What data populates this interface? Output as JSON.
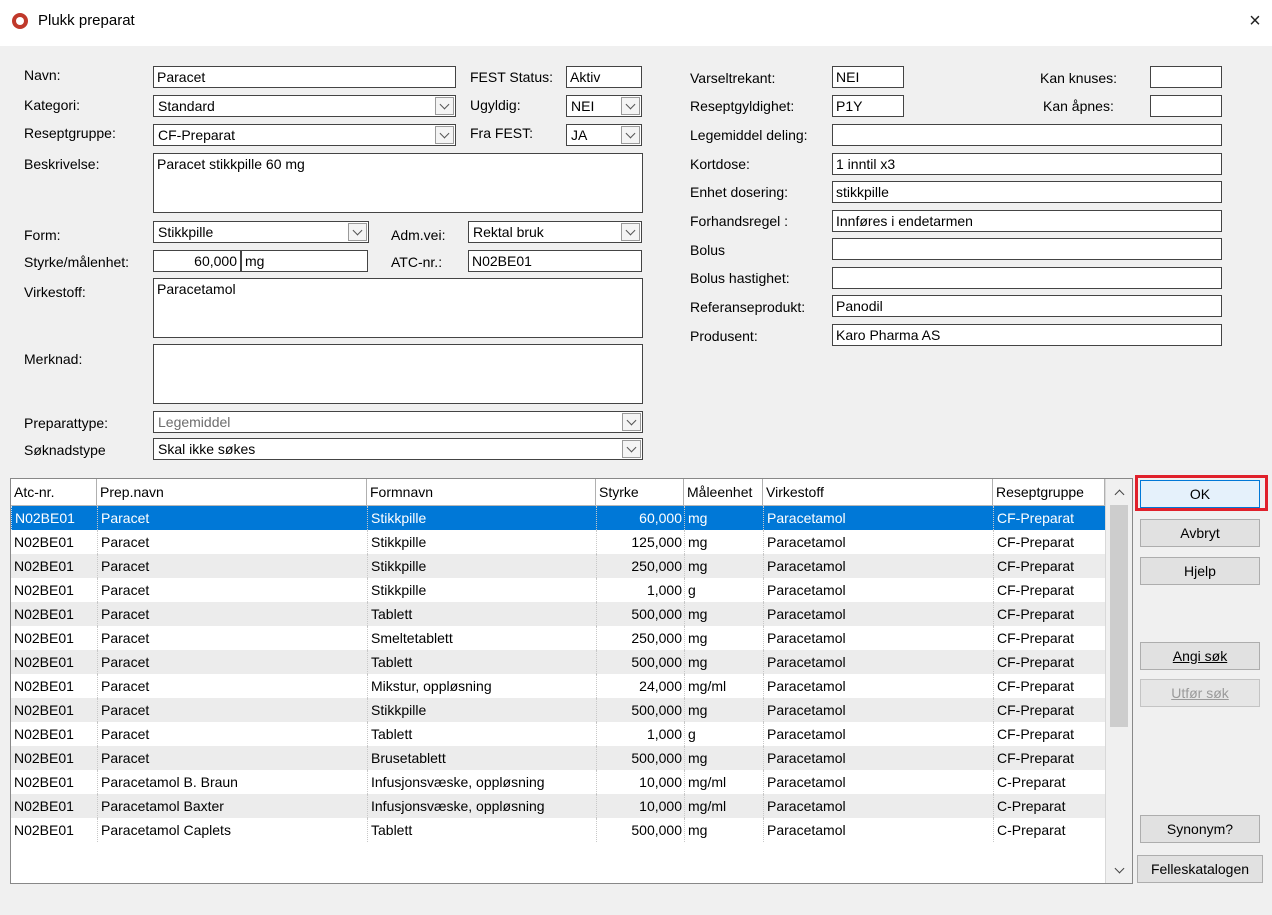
{
  "window": {
    "title": "Plukk preparat",
    "close_glyph": "×"
  },
  "form": {
    "navn_label": "Navn:",
    "navn_value": "Paracet",
    "kategori_label": "Kategori:",
    "kategori_value": "Standard",
    "reseptgruppe_label": "Reseptgruppe:",
    "reseptgruppe_value": "CF-Preparat",
    "beskrivelse_label": "Beskrivelse:",
    "beskrivelse_value": "Paracet stikkpille 60 mg",
    "fest_status_label": "FEST Status:",
    "fest_status_value": "Aktiv",
    "ugyldig_label": "Ugyldig:",
    "ugyldig_value": "NEI",
    "fra_fest_label": "Fra FEST:",
    "fra_fest_value": "JA",
    "form_label": "Form:",
    "form_value": "Stikkpille",
    "adm_vei_label": "Adm.vei:",
    "adm_vei_value": "Rektal bruk",
    "styrke_label": "Styrke/målenhet:",
    "styrke_value": "60,000",
    "maleenhet_value": "mg",
    "atc_label": "ATC-nr.:",
    "atc_value": "N02BE01",
    "virkestoff_label": "Virkestoff:",
    "virkestoff_value": "Paracetamol",
    "merknad_label": "Merknad:",
    "merknad_value": "",
    "preparattype_label": "Preparattype:",
    "preparattype_value": "Legemiddel",
    "soknadstype_label": "Søknadstype",
    "soknadstype_value": "Skal ikke søkes",
    "varseltrekant_label": "Varseltrekant:",
    "varseltrekant_value": "NEI",
    "reseptgyldighet_label": "Reseptgyldighet:",
    "reseptgyldighet_value": "P1Y",
    "kan_knuses_label": "Kan knuses:",
    "kan_knuses_value": "",
    "kan_apnes_label": "Kan åpnes:",
    "kan_apnes_value": "",
    "legemiddel_deling_label": "Legemiddel deling:",
    "legemiddel_deling_value": "",
    "kortdose_label": "Kortdose:",
    "kortdose_value": "1 inntil x3",
    "enhet_dosering_label": "Enhet dosering:",
    "enhet_dosering_value": "stikkpille",
    "forhandsregel_label": "Forhandsregel :",
    "forhandsregel_value": "Innføres i endetarmen",
    "bolus_label": "Bolus",
    "bolus_value": "",
    "bolus_hastighet_label": "Bolus hastighet:",
    "bolus_hastighet_value": "",
    "referanseprodukt_label": "Referanseprodukt:",
    "referanseprodukt_value": "Panodil",
    "produsent_label": "Produsent:",
    "produsent_value": "Karo Pharma AS"
  },
  "table": {
    "columns": [
      "Atc-nr.",
      "Prep.navn",
      "Formnavn",
      "Styrke",
      "Måleenhet",
      "Virkestoff",
      "Reseptgruppe"
    ],
    "selected_row": 0,
    "rows": [
      [
        "N02BE01",
        "Paracet",
        "Stikkpille",
        "60,000",
        "mg",
        "Paracetamol",
        "CF-Preparat"
      ],
      [
        "N02BE01",
        "Paracet",
        "Stikkpille",
        "125,000",
        "mg",
        "Paracetamol",
        "CF-Preparat"
      ],
      [
        "N02BE01",
        "Paracet",
        "Stikkpille",
        "250,000",
        "mg",
        "Paracetamol",
        "CF-Preparat"
      ],
      [
        "N02BE01",
        "Paracet",
        "Stikkpille",
        "1,000",
        "g",
        "Paracetamol",
        "CF-Preparat"
      ],
      [
        "N02BE01",
        "Paracet",
        "Tablett",
        "500,000",
        "mg",
        "Paracetamol",
        "CF-Preparat"
      ],
      [
        "N02BE01",
        "Paracet",
        "Smeltetablett",
        "250,000",
        "mg",
        "Paracetamol",
        "CF-Preparat"
      ],
      [
        "N02BE01",
        "Paracet",
        "Tablett",
        "500,000",
        "mg",
        "Paracetamol",
        "CF-Preparat"
      ],
      [
        "N02BE01",
        "Paracet",
        "Mikstur, oppløsning",
        "24,000",
        "mg/ml",
        "Paracetamol",
        "CF-Preparat"
      ],
      [
        "N02BE01",
        "Paracet",
        "Stikkpille",
        "500,000",
        "mg",
        "Paracetamol",
        "CF-Preparat"
      ],
      [
        "N02BE01",
        "Paracet",
        "Tablett",
        "1,000",
        "g",
        "Paracetamol",
        "CF-Preparat"
      ],
      [
        "N02BE01",
        "Paracet",
        "Brusetablett",
        "500,000",
        "mg",
        "Paracetamol",
        "CF-Preparat"
      ],
      [
        "N02BE01",
        "Paracetamol B. Braun",
        "Infusjonsvæske, oppløsning",
        "10,000",
        "mg/ml",
        "Paracetamol",
        "C-Preparat"
      ],
      [
        "N02BE01",
        "Paracetamol Baxter",
        "Infusjonsvæske, oppløsning",
        "10,000",
        "mg/ml",
        "Paracetamol",
        "C-Preparat"
      ],
      [
        "N02BE01",
        "Paracetamol Caplets",
        "Tablett",
        "500,000",
        "mg",
        "Paracetamol",
        "C-Preparat"
      ]
    ]
  },
  "buttons": {
    "ok": "OK",
    "avbryt": "Avbryt",
    "hjelp": "Hjelp",
    "angi_sok": "Angi søk",
    "utfor_sok": "Utfør søk",
    "synonym": "Synonym?",
    "felleskatalogen": "Felleskatalogen"
  },
  "colors": {
    "selection": "#0078d7",
    "focus_highlight": "#e0202b"
  },
  "icons": {
    "app": "app-logo-icon",
    "close": "close-icon",
    "dropdown": "chevron-down-icon"
  }
}
